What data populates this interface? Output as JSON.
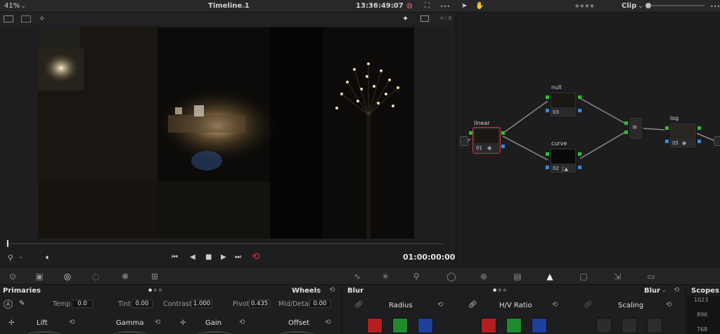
{
  "topbar": {
    "zoom": "41%",
    "timeline_title": "Timeline 1",
    "timecode": "13:36:49:07",
    "ab_label": "A / B",
    "clip_mode": "Clip",
    "more": "•••"
  },
  "playback": {
    "current_timecode": "01:00:00:00"
  },
  "nodes": {
    "linear": {
      "label": "linear",
      "num": "01"
    },
    "null": {
      "label": "null",
      "num": "03"
    },
    "curve": {
      "label": "curve",
      "num": "02"
    },
    "log": {
      "label": "log",
      "num": "05"
    }
  },
  "primaries": {
    "title": "Primaries",
    "mode": "Wheels",
    "temp_label": "Temp",
    "temp_value": "0.0",
    "tint_label": "Tint",
    "tint_value": "0.00",
    "contrast_label": "Contrast",
    "contrast_value": "1.000",
    "pivot_label": "Pivot",
    "pivot_value": "0.435",
    "middetail_label": "Mid/Detail",
    "middetail_value": "0.00",
    "wheels": [
      "Lift",
      "Gamma",
      "Gain",
      "Offset"
    ]
  },
  "blur": {
    "title": "Blur",
    "mode": "Blur",
    "radius_label": "Radius",
    "hv_label": "H/V Ratio",
    "scaling_label": "Scaling",
    "colors": {
      "red": "#b31e1e",
      "green": "#1e8a2e",
      "blue": "#1f3f9c"
    }
  },
  "scopes": {
    "title": "Scopes",
    "ticks": [
      "1023",
      "896",
      "768"
    ]
  },
  "colors": {
    "accent_red": "#d32f2f",
    "connector_green": "#2fbf2f",
    "connector_blue": "#3a8ad6"
  }
}
